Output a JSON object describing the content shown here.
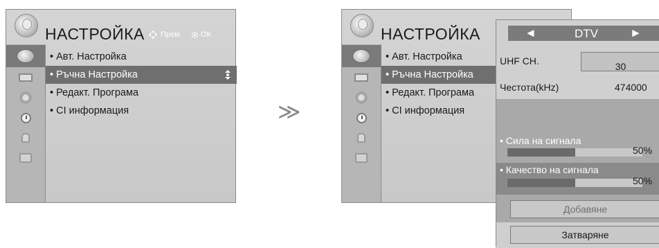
{
  "left_menu": {
    "title": "НАСТРОЙКА",
    "hints": {
      "move": "Прем.",
      "ok": "OK"
    },
    "items": [
      "• Авт. Настройка",
      "• Ръчна Настройка",
      "• Редакт. Програма",
      "• CI информация"
    ]
  },
  "right_menu": {
    "title": "НАСТРОЙКА",
    "items": [
      "• Авт. Настройка",
      "• Ръчна Настройка",
      "• Редакт. Програма",
      "• CI информация"
    ]
  },
  "separator": "≫",
  "popup": {
    "band": "DTV",
    "left_arrow": "◄",
    "right_arrow": "►",
    "channel_label": "UHF CH.",
    "channel_value": "30",
    "frequency_label": "Честота(kHz)",
    "frequency_value": "474000",
    "signal_strength": {
      "label": "• Сила на сигнала",
      "value": "50%",
      "level": 0.5
    },
    "signal_quality": {
      "label": "• Качество на сигнала",
      "value": "50%",
      "level": 0.5
    },
    "add_button": "Добавяне",
    "close_button": "Затваряне"
  },
  "colors": {
    "menu_bg": "#cccccc",
    "selection": "#6f6f6f",
    "sidebar": "#b6b6b6",
    "popup_dark": "#8a8a8a"
  }
}
